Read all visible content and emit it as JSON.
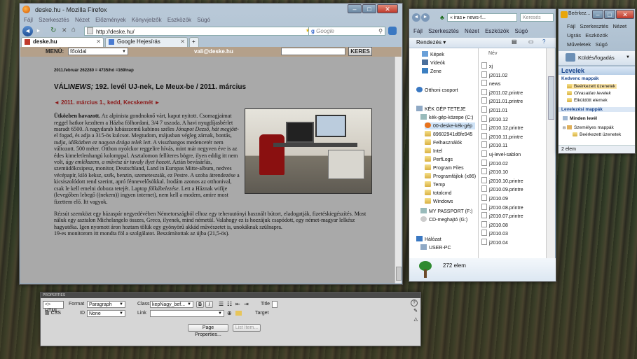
{
  "firefox": {
    "title": "deske.hu - Mozilla Firefox",
    "menu": [
      "Fájl",
      "Szerkesztés",
      "Nézet",
      "Előzmények",
      "Könyvjelzők",
      "Eszközök",
      "Súgó"
    ],
    "url": "http://deske.hu/",
    "search_placeholder": "Google",
    "tabs": [
      {
        "label": "deske.hu"
      },
      {
        "label": "Google Hejesírás"
      }
    ],
    "new_tab": "+",
    "site": {
      "menu_label": "MENÜ:",
      "menu_value": "főoldal",
      "email": "vali@deske.hu",
      "search_button": "KERES",
      "meta": "2011.február 262280 = 4735/hó =169/nap",
      "headline_prefix": "VÁLI",
      "headline_italic": "NEWS;",
      "headline_rest": " 192. levél UJ-nek, Le Meux-be / 2011. március",
      "dateline": "◄ 2011. március 1., kedd, Kecskemét ►",
      "lead_title": "Ütközben havazott.",
      "p1a": " Az alpinista gondnoknő várt, kaput nyitott. Csomagjaimat reggel hatkor kezdtem a Házba fölhordani, 3/4 7 uszoda. A havi nyugdíjasbérlet maradt 6500. A nagydarab lubásszemű kabinos széles ",
      "p1b": "Jónapot Dezső, hát megjött",
      "p1c": "-el fogad, és adja a 315-ös kulcsot. Megtudom, májusban végleg zárnak, bontás, ",
      "p1d": "tudja, időközben ez nagyon drága telek lett",
      "p1e": ". A visszhangos medencetér nem változott. 500 méter. Otthon nyolckor reggelire hívás, mint már negyven éve is az édes kimeletlenhangú kolomppal. Asztalomon fellíteres bögre, ilyen eddig itt nem volt, ",
      "p1f": "úgy emlékszem, a művész úr tavaly ilyet hozott",
      "p1g": ". Aztán bevásárlás, szemüdőkcsipesz, monitor, Deutschland, Land in Europas Mitte-album, nedves vécépapír, kiló keksz, szék, benzin, szemeteszsák, ez Pestre. A szoba átrendezése a kicsiszolódott rend szerint, apró fénnevelősökkal. Irodám azonos az otthonival, csak le kell emelni doboza tetejét. Laptop ",
      "p1h": "fölkábelezése",
      "p1i": ". Lett a Háznak wifije (levegőben lebegő ((nekem)) ingyen internet), nem kell a modem, amire most fizettem elő. Itt vagyok.",
      "p2": "Rézsút szemközt egy házaspár negyedévében Németországból elhoz egy teherautónyi használt bútort, eladogatják, fizetéskiegészítés. Most náluk egy asztalon Michelangelo összes, Greco, ilyenek, mind németül. Valahogy ez is hozzájuk csapódott, egy német-magyar lelkész hagyatéka. Igen nyomott áron hoztam tőlük egy gyönyörű akkád művészetet is, unokáknak szülnapra.",
      "p3": "19-es monitorom itt mondta föl a szolgálatot. Beszámítottak az újba (21,5-ös)."
    }
  },
  "dreamweaver": {
    "panel_title": "PROPERTIES",
    "html_tab": "HTML",
    "css_tab": "CSS",
    "format_label": "Format",
    "format_value": "Paragraph",
    "id_label": "ID",
    "id_value": "None",
    "class_label": "Class",
    "class_value": "kepNagy_bef...",
    "link_label": "Link",
    "title_label": "Title",
    "target_label": "Target",
    "bold": "B",
    "italic": "I",
    "page_props_button": "Page Properties...",
    "list_item_button": "List Item..."
  },
  "explorer": {
    "breadcrumb": "« iras ▸ news-f...",
    "search_placeholder": "Keresés",
    "menu": [
      "Fájl",
      "Szerkesztés",
      "Nézet",
      "Eszközök",
      "Súgó"
    ],
    "organize": "Rendezés ▾",
    "name_col": "Név",
    "nav": [
      {
        "label": "Képek"
      },
      {
        "label": "Videók"
      },
      {
        "label": "Zene"
      },
      {
        "label": "Otthoni csoport"
      },
      {
        "label": "KÉK GÉP TETEJE"
      },
      {
        "label": "kék-gép-közepe (C:)"
      },
      {
        "label": "00-deske-kék-gép"
      },
      {
        "label": "89602941d6fe945"
      },
      {
        "label": "Felhasználók"
      },
      {
        "label": "Intel"
      },
      {
        "label": "PerfLogs"
      },
      {
        "label": "Program Files"
      },
      {
        "label": "Programfájlok (x86)"
      },
      {
        "label": "Temp"
      },
      {
        "label": "totalcmd"
      },
      {
        "label": "Windows"
      },
      {
        "label": "MY PASSPORT (F:)"
      },
      {
        "label": "CD-meghajtó (G:)"
      },
      {
        "label": "Hálózat"
      },
      {
        "label": "USER-PC"
      }
    ],
    "files": [
      "xj",
      "j2011.02",
      "news",
      "j2011.02.printre",
      "j2011.01.printre",
      "j2011.01",
      "j2010.12",
      "j2010.12.printre",
      "j2010.11.printre",
      "j2010.11",
      "uj-level-sablon",
      "j2010.02",
      "j2010.10",
      "j2010.10.printre",
      "j2010.09.printre",
      "j2010.09",
      "j2010.08.printre",
      "j2010.07.printre",
      "j2010.08",
      "j2010.03",
      "j2010.04"
    ],
    "count": "272 elem"
  },
  "mail": {
    "title": "Beérkez...",
    "menu1": [
      "Fájl",
      "Szerkesztés",
      "Nézet"
    ],
    "menu2": [
      "Ugrás",
      "Eszközök"
    ],
    "menu3": [
      "Műveletek",
      "Súgó"
    ],
    "sendrecv": "Küldés/fogadás",
    "levelek": "Levelek",
    "fav_title": "Kedvenc mappák",
    "fav": [
      "Beérkezett üzenetek",
      "Olvasatlan levelek",
      "Elküldött elemek"
    ],
    "mailbox_title": "Levelezési mappák",
    "all_mail": "Minden levél",
    "tree": [
      "Személyes mappák",
      "Beérkezett üzenetek"
    ],
    "count": "2 elem"
  },
  "colors": {
    "accent": "#2a5fa8",
    "site_bar": "#b4a08a",
    "dateline": "#8b1a1a"
  }
}
